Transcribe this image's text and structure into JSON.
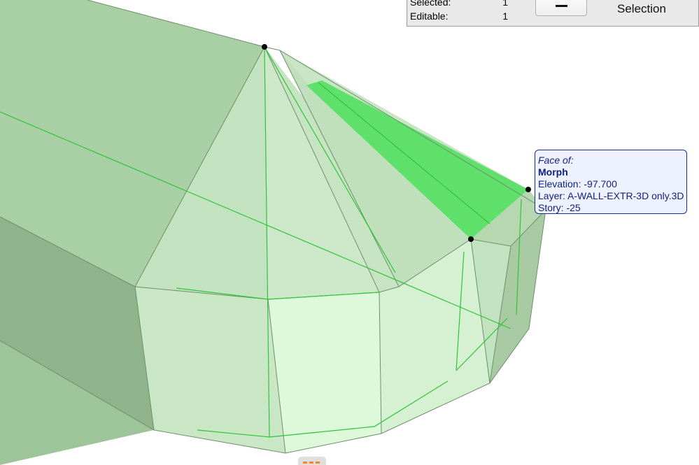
{
  "info_panel": {
    "selected_label": "Selected:",
    "selected_value": "1",
    "editable_label": "Editable:",
    "editable_value": "1",
    "selection_label": "Selection"
  },
  "tooltip": {
    "header": "Face of:",
    "element_type": "Morph",
    "elevation": "Elevation: -97.700",
    "layer": "Layer: A-WALL-EXTR-3D only.3D",
    "story": "Story: -25"
  },
  "colors": {
    "morph_fill": "#b9dcb5",
    "morph_edge": "#2fc43a",
    "selected_face": "#5fe06b",
    "tooltip_text": "#101e80",
    "tooltip_border": "#1c2a8f"
  },
  "icons": {
    "minus": "minus-icon",
    "node": "node-point-icon",
    "tab": "palette-tab-icon"
  }
}
